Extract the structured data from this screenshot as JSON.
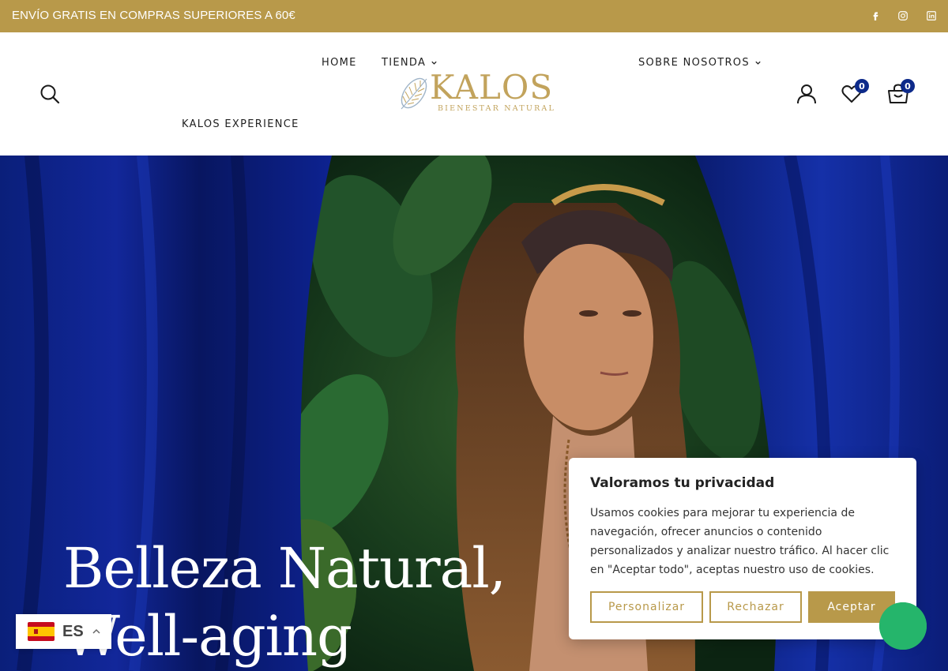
{
  "topbar": {
    "announcement": "ENVÍO GRATIS EN COMPRAS SUPERIORES A 60€",
    "socials": [
      "facebook-icon",
      "instagram-icon",
      "linkedin-icon"
    ]
  },
  "nav": {
    "home": "HOME",
    "tienda": "TIENDA",
    "sobre": "SOBRE NOSOTROS",
    "experience": "KALOS EXPERIENCE"
  },
  "logo": {
    "name": "KALOS",
    "tagline": "BIENESTAR NATURAL"
  },
  "header_icons": {
    "wishlist_count": "0",
    "cart_count": "0"
  },
  "hero": {
    "title": "Belleza Natural, Well-aging"
  },
  "cookie": {
    "title": "Valoramos tu privacidad",
    "text": "Usamos cookies para mejorar tu experiencia de navegación, ofrecer anuncios o contenido personalizados y analizar nuestro tráfico. Al hacer clic en \"Aceptar todo\", aceptas nuestro uso de cookies.",
    "customize": "Personalizar",
    "reject": "Rechazar",
    "accept": "Aceptar"
  },
  "language": {
    "code": "ES"
  },
  "colors": {
    "brand_gold": "#b8994a",
    "badge_blue": "#0d2a8a",
    "chat_green": "#25b56b"
  }
}
